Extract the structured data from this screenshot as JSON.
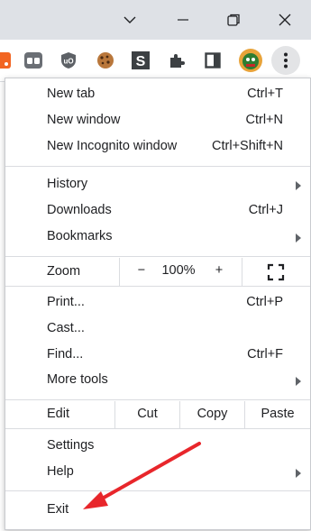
{
  "window": {
    "controls": [
      "chevron-down-icon",
      "minimize-icon",
      "restore-icon",
      "close-icon"
    ],
    "titlebar_color": "#dee1e6"
  },
  "toolbar": {
    "extensions": [
      "rss-icon",
      "visor-extension-icon",
      "ublock-icon",
      "cookie-icon",
      "s-extension-icon",
      "puzzle-icon",
      "sidepanel-icon"
    ],
    "profile": "avatar",
    "menu_button": "kebab-menu-icon"
  },
  "menu": {
    "new_tab": {
      "label": "New tab",
      "shortcut": "Ctrl+T"
    },
    "new_window": {
      "label": "New window",
      "shortcut": "Ctrl+N"
    },
    "new_incognito": {
      "label": "New Incognito window",
      "shortcut": "Ctrl+Shift+N"
    },
    "history": {
      "label": "History"
    },
    "downloads": {
      "label": "Downloads",
      "shortcut": "Ctrl+J"
    },
    "bookmarks": {
      "label": "Bookmarks"
    },
    "zoom": {
      "label": "Zoom",
      "minus": "−",
      "value": "100%",
      "plus": "+"
    },
    "print": {
      "label": "Print...",
      "shortcut": "Ctrl+P"
    },
    "cast": {
      "label": "Cast..."
    },
    "find": {
      "label": "Find...",
      "shortcut": "Ctrl+F"
    },
    "more_tools": {
      "label": "More tools"
    },
    "edit": {
      "label": "Edit",
      "cut": "Cut",
      "copy": "Copy",
      "paste": "Paste"
    },
    "settings": {
      "label": "Settings"
    },
    "help": {
      "label": "Help"
    },
    "exit": {
      "label": "Exit"
    }
  },
  "annotation": {
    "color": "#e8262b"
  }
}
